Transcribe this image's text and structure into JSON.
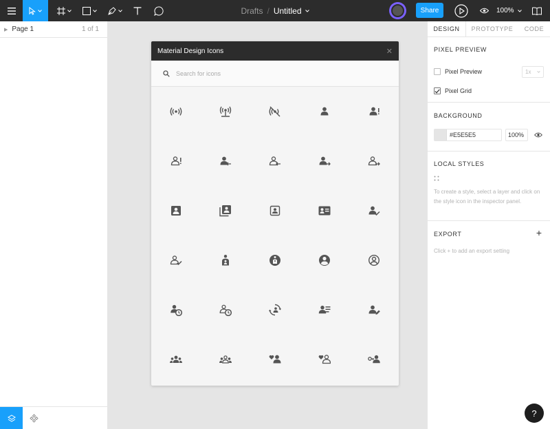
{
  "toolbar": {
    "breadcrumb_root": "Drafts",
    "breadcrumb_sep": "/",
    "document_title": "Untitled",
    "share_label": "Share",
    "zoom_label": "100%"
  },
  "left_panel": {
    "page_name": "Page 1",
    "page_count": "1 of 1"
  },
  "modal": {
    "title": "Material Design Icons",
    "close_glyph": "✕",
    "search_placeholder": "Search for icons",
    "icons": [
      "broadcast-wifi-icon",
      "wifi-tethering-icon",
      "portable-wifi-off-icon",
      "person-icon",
      "person-alert-icon",
      "person-alert-outline-icon",
      "person-arrow-left-icon",
      "person-arrow-left-outline-icon",
      "person-arrow-right-icon",
      "person-arrow-right-outline-icon",
      "account-box-icon",
      "account-multiple-box-icon",
      "account-box-outline-icon",
      "account-card-details-icon",
      "account-check-icon",
      "account-check-outline-icon",
      "account-child-icon",
      "account-child-circle-icon",
      "account-circle-icon",
      "account-circle-outline-icon",
      "account-clock-icon",
      "account-clock-outline-icon",
      "account-convert-icon",
      "account-details-icon",
      "account-edit-icon",
      "account-group-icon",
      "account-group-outline-icon",
      "account-heart-icon",
      "account-heart-outline-icon",
      "account-key-icon"
    ]
  },
  "right_panel": {
    "tabs": [
      "DESIGN",
      "PROTOTYPE",
      "CODE"
    ],
    "pixel_preview_title": "PIXEL PREVIEW",
    "pixel_preview_label": "Pixel Preview",
    "pixel_preview_scale": "1x",
    "pixel_grid_label": "Pixel Grid",
    "background_title": "BACKGROUND",
    "background_hex": "#E5E5E5",
    "background_opacity": "100%",
    "local_styles_title": "LOCAL STYLES",
    "local_styles_help": "To create a style, select a layer and click on the style icon in the inspector panel.",
    "export_title": "EXPORT",
    "export_help": "Click + to add an export setting",
    "help_label": "?"
  },
  "colors": {
    "accent": "#18a0fb",
    "toolbar_bg": "#2c2c2c",
    "canvas_bg": "#e5e5e5",
    "icon_fill": "#555555"
  }
}
